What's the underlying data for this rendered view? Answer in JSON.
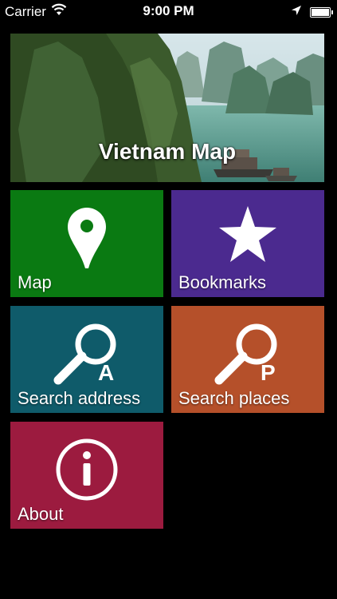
{
  "status_bar": {
    "carrier": "Carrier",
    "time": "9:00 PM"
  },
  "banner": {
    "title": "Vietnam Map"
  },
  "tiles": [
    {
      "label": "Map",
      "icon": "map-pin-icon",
      "color": "#0a7a12"
    },
    {
      "label": "Bookmarks",
      "icon": "star-icon",
      "color": "#4b2a8f"
    },
    {
      "label": "Search address",
      "icon": "magnifier-a-icon",
      "icon_letter": "A",
      "color": "#0f5b6a"
    },
    {
      "label": "Search places",
      "icon": "magnifier-p-icon",
      "icon_letter": "P",
      "color": "#b5502a"
    },
    {
      "label": "About",
      "icon": "info-icon",
      "color": "#9c1b3f"
    }
  ]
}
